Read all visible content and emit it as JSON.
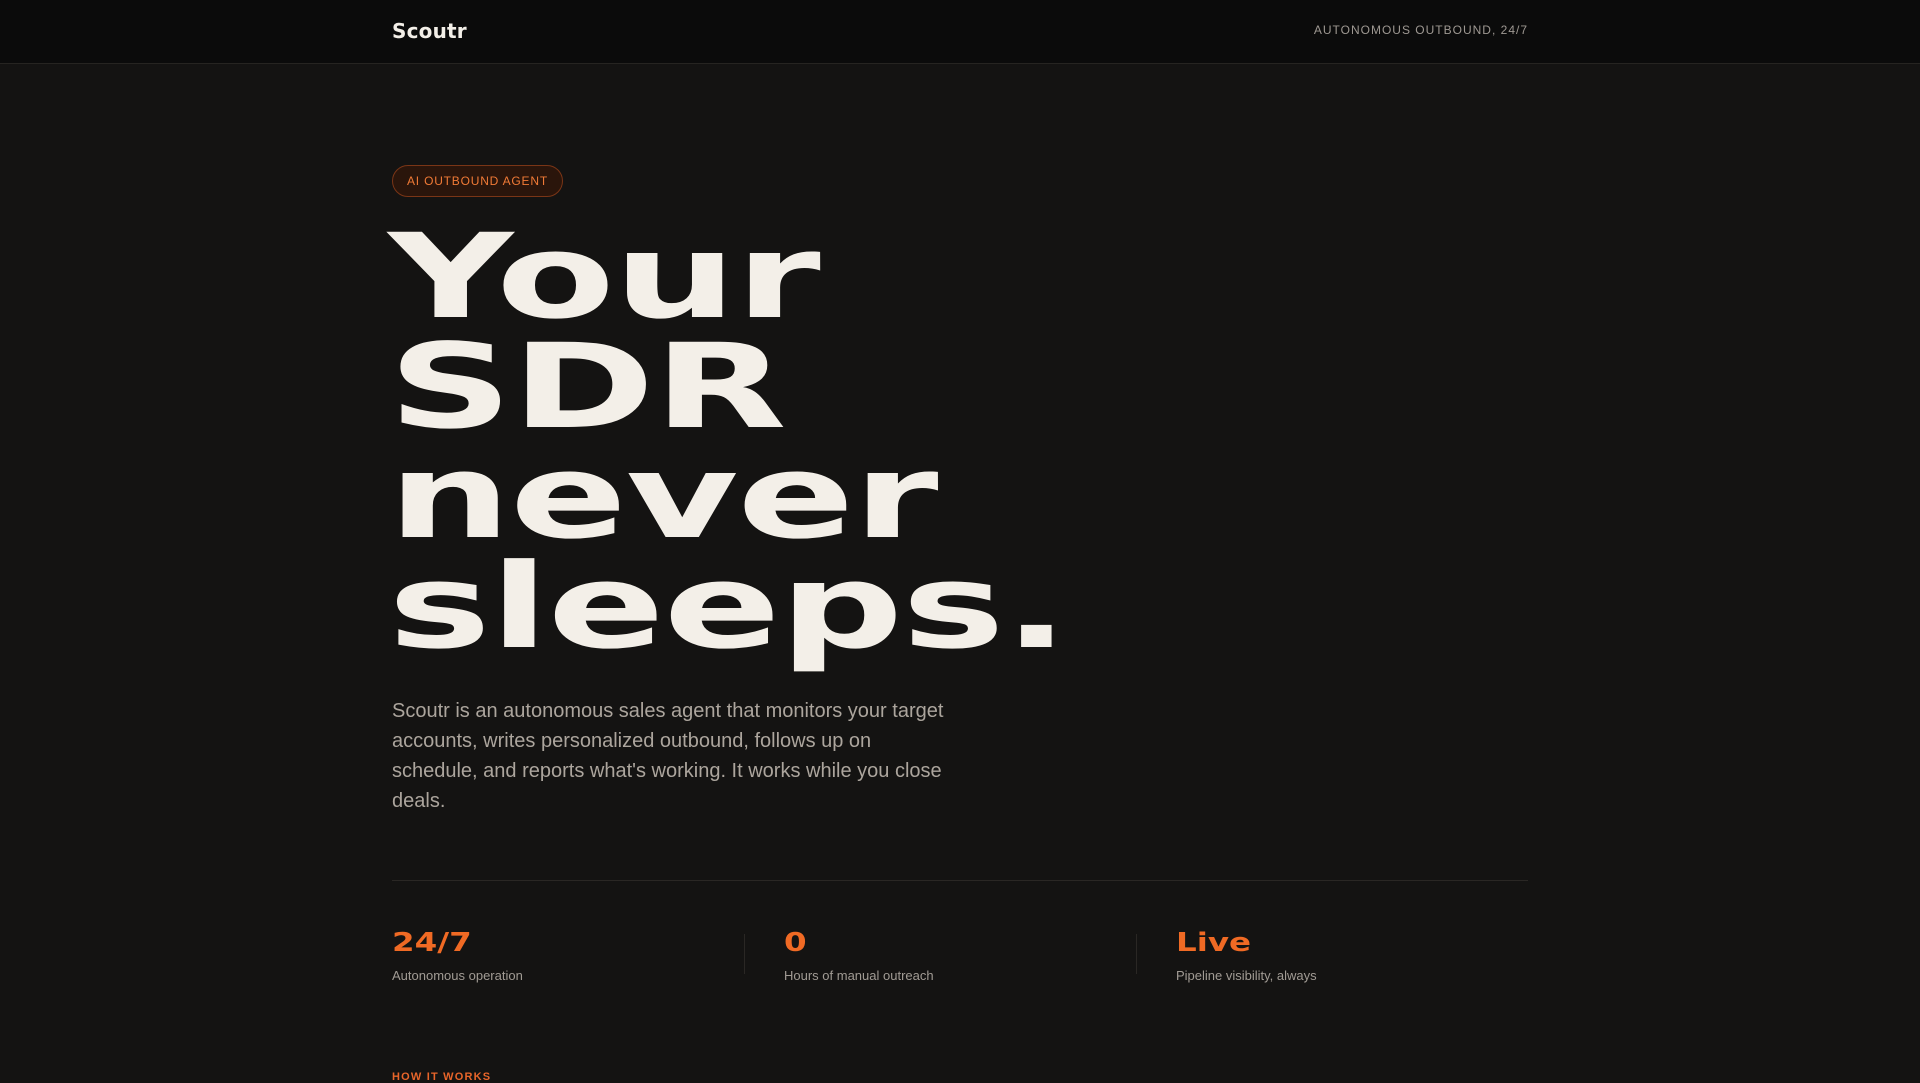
{
  "header": {
    "logo": "Scoutr",
    "tagline": "AUTONOMOUS OUTBOUND, 24/7"
  },
  "hero": {
    "badge": "AI OUTBOUND AGENT",
    "headline_lines": [
      "Your",
      "SDR",
      "never",
      "sleeps."
    ],
    "intro": "Scoutr is an autonomous sales agent that monitors your target accounts, writes personalized outbound, follows up on schedule, and reports what's working. It works while you close deals."
  },
  "stats": [
    {
      "value": "24/7",
      "label": "Autonomous operation"
    },
    {
      "value": "0",
      "label": "Hours of manual outreach"
    },
    {
      "value": "Live",
      "label": "Pipeline visibility, always"
    }
  ],
  "next_section": {
    "label": "HOW IT WORKS"
  },
  "colors": {
    "background": "#141312",
    "accent": "#f06a24",
    "text": "#f3efe8"
  }
}
